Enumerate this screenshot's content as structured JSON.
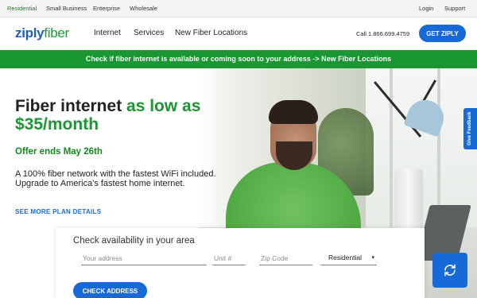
{
  "util_nav": {
    "items": [
      "Residential",
      "Small Business",
      "Enterprise",
      "Wholesale"
    ],
    "login": "Login",
    "support": "Support"
  },
  "header": {
    "logo_ziply": "ziply",
    "logo_fiber": "fiber",
    "nav": [
      "Internet",
      "Services",
      "New Fiber Locations"
    ],
    "phone": "Call 1.866.699.4759",
    "cta": "GET ZIPLY"
  },
  "banner": {
    "text": "Check if fiber internet is available or coming soon to your address -> New Fiber Locations"
  },
  "hero": {
    "title_part1": "Fiber internet ",
    "title_part2": "as low as $35/month",
    "offer": "Offer ends May 26th",
    "description": "A 100% fiber network with the fastest WiFi included. Upgrade to America's fastest home internet.",
    "plan_link": "SEE MORE PLAN DETAILS"
  },
  "feedback": {
    "label": "Give Feedback"
  },
  "availability": {
    "title": "Check availability in your area",
    "address_placeholder": "Your address",
    "unit_placeholder": "Unit #",
    "zip_placeholder": "Zip Code",
    "type_selected": "Residential",
    "button": "CHECK ADDRESS"
  },
  "colors": {
    "brand_blue": "#1769d8",
    "brand_green": "#1a9632",
    "nav_active": "#148a1e"
  },
  "icons": {
    "fab": "refresh-icon",
    "select": "chevron-down-icon"
  }
}
